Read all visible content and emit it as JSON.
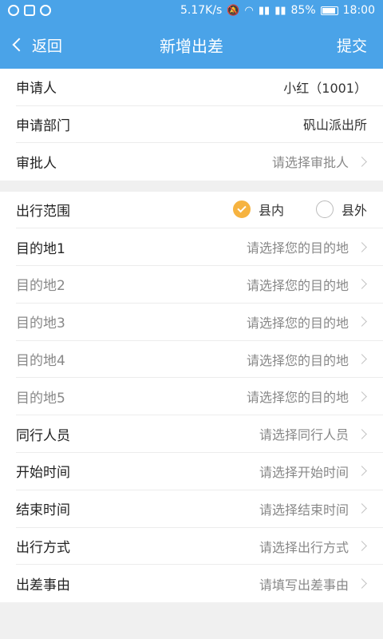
{
  "status_bar": {
    "network_speed": "5.17K/s",
    "battery_percent": "85%",
    "time": "18:00"
  },
  "nav": {
    "back_label": "返回",
    "title": "新增出差",
    "submit_label": "提交"
  },
  "info": {
    "applicant_label": "申请人",
    "applicant_value": "小红（1001）",
    "department_label": "申请部门",
    "department_value": "矾山派出所",
    "approver_label": "审批人",
    "approver_placeholder": "请选择审批人"
  },
  "form": {
    "scope_label": "出行范围",
    "scope_options": [
      "县内",
      "县外"
    ],
    "scope_selected": "县内",
    "destinations": [
      {
        "label": "目的地1",
        "placeholder": "请选择您的目的地"
      },
      {
        "label": "目的地2",
        "placeholder": "请选择您的目的地"
      },
      {
        "label": "目的地3",
        "placeholder": "请选择您的目的地"
      },
      {
        "label": "目的地4",
        "placeholder": "请选择您的目的地"
      },
      {
        "label": "目的地5",
        "placeholder": "请选择您的目的地"
      }
    ],
    "companions_label": "同行人员",
    "companions_placeholder": "请选择同行人员",
    "start_label": "开始时间",
    "start_placeholder": "请选择开始时间",
    "end_label": "结束时间",
    "end_placeholder": "请选择结束时间",
    "transport_label": "出行方式",
    "transport_placeholder": "请选择出行方式",
    "reason_label": "出差事由",
    "reason_placeholder": "请填写出差事由"
  },
  "colors": {
    "accent": "#4aa3e8",
    "radio_checked": "#f6b340"
  }
}
